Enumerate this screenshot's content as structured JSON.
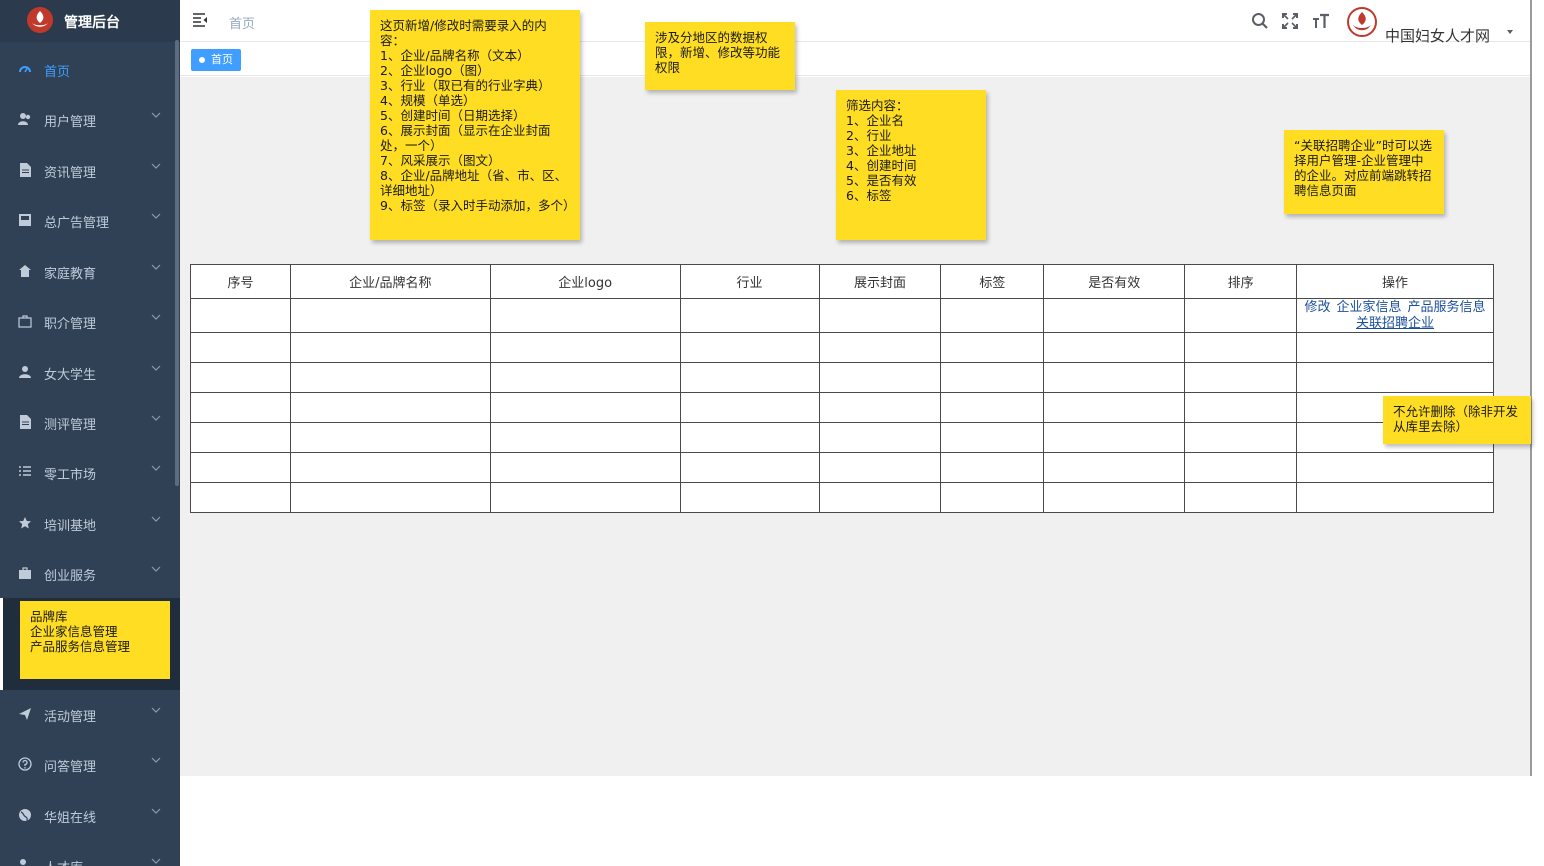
{
  "app": {
    "title": "管理后台"
  },
  "sidebar": {
    "items": [
      {
        "label": "首页",
        "icon": "dashboard-icon"
      },
      {
        "label": "用户管理",
        "icon": "users-icon"
      },
      {
        "label": "资讯管理",
        "icon": "document-icon"
      },
      {
        "label": "总广告管理",
        "icon": "ad-icon"
      },
      {
        "label": "家庭教育",
        "icon": "home-icon"
      },
      {
        "label": "职介管理",
        "icon": "briefcase-icon"
      },
      {
        "label": "女大学生",
        "icon": "user-icon"
      },
      {
        "label": "测评管理",
        "icon": "document-icon"
      },
      {
        "label": "零工市场",
        "icon": "list-icon"
      },
      {
        "label": "培训基地",
        "icon": "star-icon"
      },
      {
        "label": "创业服务",
        "icon": "briefcase-icon"
      },
      {
        "label": "活动管理",
        "icon": "send-icon"
      },
      {
        "label": "问答管理",
        "icon": "question-icon"
      },
      {
        "label": "华姐在线",
        "icon": "globe-icon"
      },
      {
        "label": "人才库",
        "icon": "people-icon"
      }
    ],
    "sub_note": "品牌库\n企业家信息管理\n产品服务信息管理"
  },
  "header": {
    "breadcrumb": "首页",
    "site_name": "中国妇女人才网",
    "icons": [
      "search-icon",
      "fullscreen-icon",
      "font-size-icon"
    ]
  },
  "tags": {
    "active": "首页"
  },
  "notes": {
    "fields": "这页新增/修改时需要录入的内容：\n1、企业/品牌名称（文本）\n2、企业logo（图）\n3、行业（取已有的行业字典）\n4、规模（单选）\n5、创建时间（日期选择）\n6、展示封面（显示在企业封面处，一个）\n7、风采展示（图文）\n8、企业/品牌地址（省、市、区、详细地址）\n9、标签（录入时手动添加，多个）",
    "permission": "涉及分地区的数据权限，新增、修改等功能权限",
    "filters": "筛选内容：\n1、企业名\n2、行业\n3、企业地址\n4、创建时间\n5、是否有效\n6、标签",
    "relation": "“关联招聘企业”时可以选择用户管理-企业管理中的企业。对应前端跳转招聘信息页面",
    "delete": "不允许删除（除非开发从库里去除）"
  },
  "table": {
    "columns": [
      "序号",
      "企业/品牌名称",
      "企业logo",
      "行业",
      "展示封面",
      "标签",
      "是否有效",
      "排序",
      "操作"
    ],
    "row_actions": [
      "修改",
      "企业家信息",
      "产品服务信息",
      "关联招聘企业"
    ]
  },
  "colors": {
    "sidebar_bg": "#304156",
    "accent": "#409eff",
    "note_bg": "#ffdd22"
  }
}
